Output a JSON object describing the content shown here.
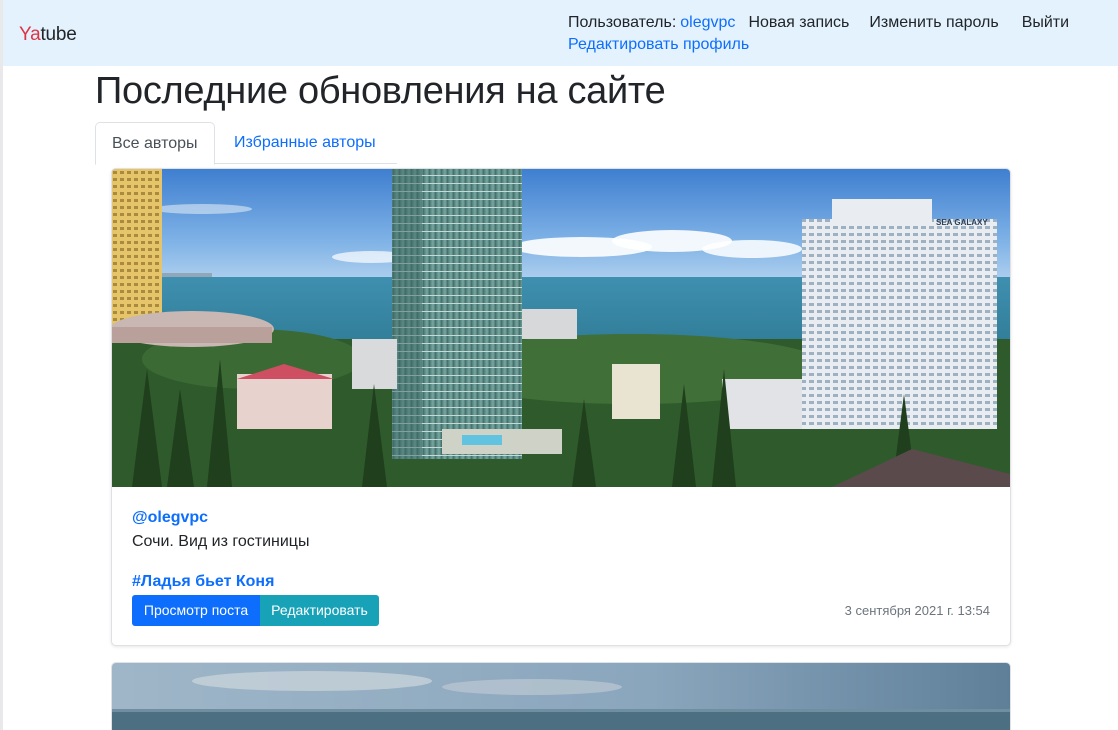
{
  "navbar": {
    "brand_accent": "Ya",
    "brand_rest": "tube",
    "user_label": "Пользователь:",
    "user_name": "olegvpc",
    "new_post": "Новая запись",
    "change_password": "Изменить пароль",
    "logout": "Выйти",
    "edit_profile": "Редактировать профиль"
  },
  "page": {
    "title": "Последние обновления на сайте"
  },
  "tabs": [
    {
      "label": "Все авторы",
      "active": true
    },
    {
      "label": "Избранные авторы",
      "active": false
    }
  ],
  "post": {
    "image_sign": "SEA GALAXY",
    "author": "@olegvpc",
    "text": "Сочи. Вид из гостиницы",
    "group": "#Ладья бьет Коня",
    "view_button": "Просмотр поста",
    "edit_button": "Редактировать",
    "date": "3 сентября 2021 г. 13:54"
  },
  "colors": {
    "navbar_bg": "#e3f2fd",
    "link": "#0d6efd",
    "primary_button": "#0d6efd",
    "info_button": "#17a2b8",
    "brand_accent": "#dc3545"
  }
}
